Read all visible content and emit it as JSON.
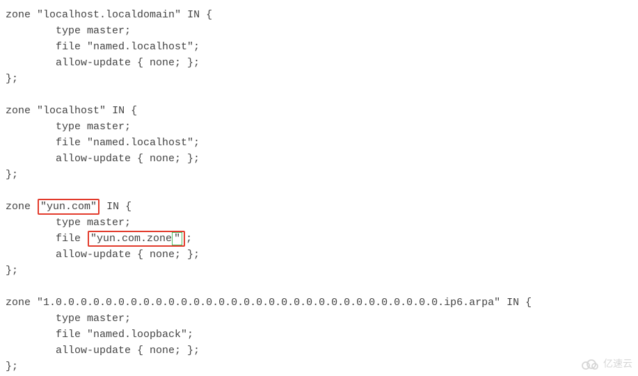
{
  "code": {
    "b1": {
      "zone_kw": "zone",
      "name": "\"localhost.localdomain\"",
      "in_open": "IN {",
      "type": "        type master;",
      "file": "        file \"named.localhost\";",
      "allow": "        allow-update { none; };",
      "close": "};"
    },
    "b2": {
      "zone_kw": "zone",
      "name": "\"localhost\"",
      "in_open": "IN {",
      "type": "        type master;",
      "file": "        file \"named.localhost\";",
      "allow": "        allow-update { none; };",
      "close": "};"
    },
    "b3": {
      "zone_kw": "zone",
      "name_hl": "\"yun.com\"",
      "in_open": "IN {",
      "type": "        type master;",
      "file_pre": "        file ",
      "file_hl_open": "\"yun.com.zone",
      "file_hl_quote": "\"",
      "file_tail": ";",
      "allow": "        allow-update { none; };",
      "close": "};"
    },
    "b4": {
      "zone_kw": "zone",
      "name": "\"1.0.0.0.0.0.0.0.0.0.0.0.0.0.0.0.0.0.0.0.0.0.0.0.0.0.0.0.0.0.0.0.ip6.arpa\"",
      "in_open": "IN {",
      "type": "        type master;",
      "file": "        file \"named.loopback\";",
      "allow": "        allow-update { none; };",
      "close": "};"
    }
  },
  "watermark": {
    "text": "亿速云"
  },
  "highlights": {
    "zone_name": "yun.com",
    "zone_file": "yun.com.zone"
  },
  "colors": {
    "highlight_red": "#e23a2b",
    "highlight_green": "#4cbf63",
    "text": "#434343"
  }
}
